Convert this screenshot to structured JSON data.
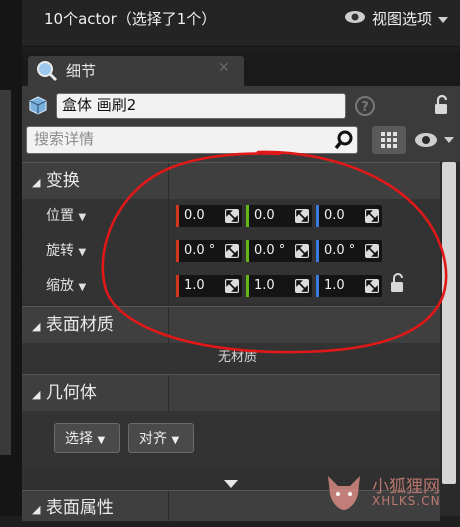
{
  "header": {
    "selection_text": "10个actor（选择了1个）",
    "view_options_label": "视图选项"
  },
  "tab": {
    "label": "细节"
  },
  "actor": {
    "name": "盒体 画刷2"
  },
  "search": {
    "placeholder": "搜索详情"
  },
  "transform": {
    "title": "变换",
    "rows": [
      {
        "label": "位置",
        "x": "0.0",
        "y": "0.0",
        "z": "0.0"
      },
      {
        "label": "旋转",
        "x": "0.0 °",
        "y": "0.0 °",
        "z": "0.0 °"
      },
      {
        "label": "缩放",
        "x": "1.0",
        "y": "1.0",
        "z": "1.0"
      }
    ]
  },
  "surface_material": {
    "title": "表面材质",
    "empty_text": "无材质"
  },
  "geometry": {
    "title": "几何体",
    "select_label": "选择",
    "align_label": "对齐"
  },
  "surface_properties": {
    "title": "表面属性"
  },
  "watermark": {
    "cn": "小狐狸网",
    "en": "XHLKS.CN"
  },
  "colors": {
    "x_axis": "#d0381d",
    "y_axis": "#66b618",
    "z_axis": "#3a7be0",
    "annotation": "#e01818"
  }
}
